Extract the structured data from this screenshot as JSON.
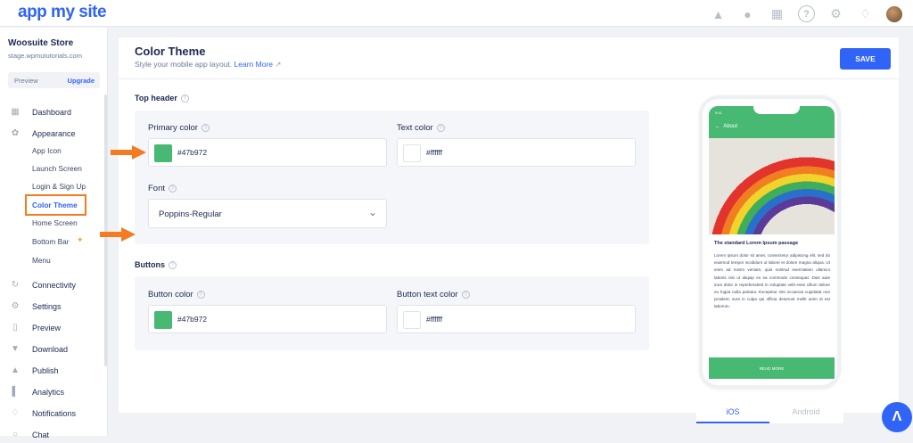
{
  "app": {
    "logo": "app my site"
  },
  "topbar": {
    "icons": [
      "android-icon",
      "apple-icon",
      "apps-grid-icon",
      "help-icon",
      "settings-icon",
      "bell-icon",
      "avatar"
    ],
    "help_glyph": "?"
  },
  "sidebar": {
    "store_name": "Woosuite Store",
    "store_url": "stage.wpmututorials.com",
    "preview": "Preview",
    "upgrade": "Upgrade",
    "items": [
      {
        "label": "Dashboard",
        "icon": "dashboard-icon"
      },
      {
        "label": "Appearance",
        "icon": "palette-icon"
      },
      {
        "label": "Connectivity",
        "icon": "connectivity-icon"
      },
      {
        "label": "Settings",
        "icon": "settings-icon"
      },
      {
        "label": "Preview",
        "icon": "preview-icon"
      },
      {
        "label": "Download",
        "icon": "download-icon"
      },
      {
        "label": "Publish",
        "icon": "publish-icon"
      },
      {
        "label": "Analytics",
        "icon": "analytics-icon"
      },
      {
        "label": "Notifications",
        "icon": "notifications-icon"
      },
      {
        "label": "Chat",
        "icon": "chat-icon"
      }
    ],
    "subitems": [
      "App Icon",
      "Launch Screen",
      "Login & Sign Up",
      "Color Theme",
      "Home Screen",
      "Bottom Bar",
      "Menu"
    ],
    "active_subitem": "Color Theme"
  },
  "main": {
    "title": "Color Theme",
    "subtitle": "Style your mobile app layout.",
    "learn_more": "Learn More",
    "save": "SAVE",
    "top_header": {
      "section": "Top header",
      "primary_label": "Primary color",
      "primary_value": "#47b972",
      "text_label": "Text color",
      "text_value": "#ffffff",
      "font_label": "Font",
      "font_value": "Poppins-Regular"
    },
    "buttons": {
      "section": "Buttons",
      "button_color_label": "Button color",
      "button_color_value": "#47b972",
      "button_text_label": "Button text color",
      "button_text_value": "#ffffff"
    }
  },
  "preview": {
    "time": "9:41",
    "header": "About",
    "article_title": "The standard Lorem Ipsum passage",
    "body": "Lorem ipsum dolor sit amet, consectetur adipiscing elit, sed do eiusmod tempor incididunt ut labore et dolore magna aliqua. Ut enim ad minim veniam, quis nostrud exercitation ullamco laboris nisi ut aliquip ex ea commodo consequat. Duis aute irure dolor in reprehenderit in voluptate velit esse cillum dolore eu fugiat nulla pariatur. Excepteur sint occaecat cupidatat non proident, sunt in culpa qui officia deserunt mollit anim id est laborum.",
    "read_more": "READ MORE",
    "tabs": [
      "iOS",
      "Android"
    ]
  },
  "colors": {
    "accent": "#3064f6",
    "primary": "#47b972",
    "annotation": "#f47b20"
  }
}
